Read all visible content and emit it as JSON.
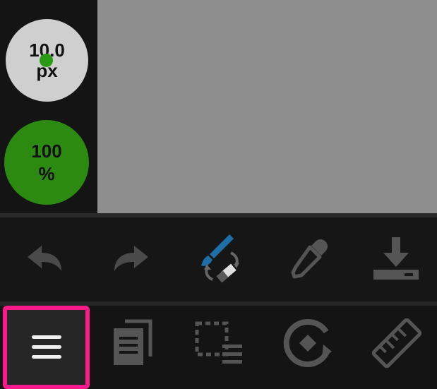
{
  "brush_size": {
    "value": "10.0",
    "unit": "px"
  },
  "brush_opacity": {
    "value": "100",
    "unit": "%"
  },
  "colors": {
    "canvas": "#8e8e8e",
    "accent_green": "#2b8a0f",
    "highlight_pink": "#ff1a8c",
    "brush_blue": "#1e6fa8"
  },
  "toolbar_top": [
    "undo-icon",
    "redo-icon",
    "brush-eraser-toggle-icon",
    "eyedropper-icon",
    "download-icon"
  ],
  "toolbar_bottom": [
    "menu-icon",
    "layers-icon",
    "selection-icon",
    "transform-icon",
    "ruler-icon"
  ]
}
